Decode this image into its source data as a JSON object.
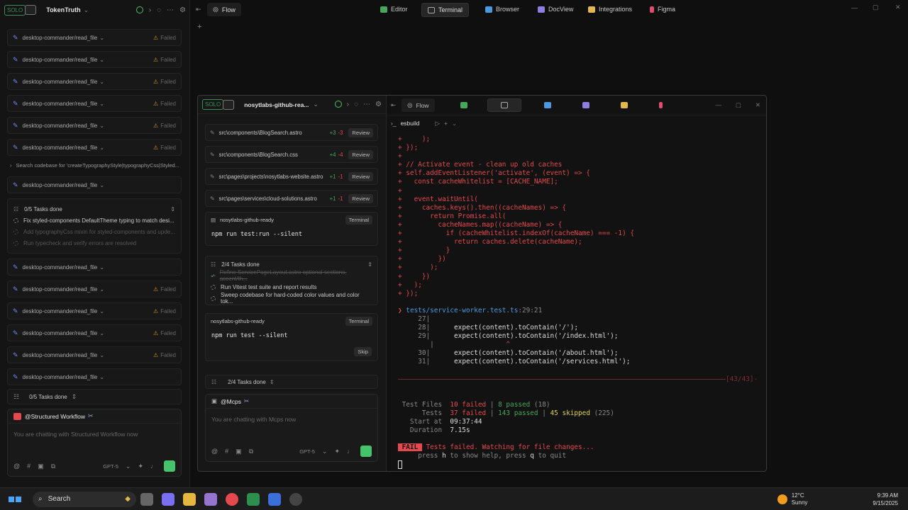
{
  "app": {
    "solo": "SOLO",
    "project": "TokenTruth",
    "top_tabs": [
      {
        "label": "Flow",
        "icon": "flow-icon"
      },
      {
        "label": "Editor",
        "icon": "editor-icon"
      },
      {
        "label": "Terminal",
        "icon": "terminal-icon"
      },
      {
        "label": "Browser",
        "icon": "browser-icon"
      },
      {
        "label": "DocView",
        "icon": "docview-icon"
      },
      {
        "label": "Integrations",
        "icon": "integrations-icon"
      },
      {
        "label": "Figma",
        "icon": "figma-icon"
      }
    ]
  },
  "left_panel": {
    "tool_label": "desktop-commander/read_file",
    "failed": "Failed",
    "search_codebase": "Search codebase for 'createTypographyStyle|typographyCss|Styled...",
    "tasks_done": "0/5 Tasks done",
    "tasks": [
      "Fix styled-components DefaultTheme typing to match desi...",
      "Add typographyCss mixin for styled-components and upde...",
      "Run typecheck and verify errors are resolved"
    ],
    "footer_tasks": "0/5 Tasks done",
    "workflow_title": "@Structured Workflow",
    "workflow_placeholder": "You are chatting with Structured Workflow now",
    "model": "GPT-5"
  },
  "inner": {
    "solo": "SOLO",
    "project": "nosytlabs-github-rea...",
    "files": [
      {
        "path": "src\\components\\BlogSearch.astro",
        "add": "+3",
        "del": "-3"
      },
      {
        "path": "src\\components\\BlogSearch.css",
        "add": "+4",
        "del": "-4"
      },
      {
        "path": "src\\pages\\projects\\nosytlabs-website.astro",
        "add": "+1",
        "del": "-1"
      },
      {
        "path": "src\\pages\\services\\cloud-solutions.astro",
        "add": "+1",
        "del": "-1"
      }
    ],
    "review": "Review",
    "terminal_label": "Terminal",
    "cmd1_project": "nosytlabs-github-ready",
    "cmd1": "npm run test:run --silent",
    "tasks_done": "2/4 Tasks done",
    "tasks": [
      "Refine ServicePageLayout.astro optional sections, accent/th...",
      "Run Vitest test suite and report results",
      "Sweep codebase for hard-coded color values and color tok..."
    ],
    "cmd2_project": "nosytlabs-github-ready",
    "cmd2": "npm run test --silent",
    "skip": "Skip",
    "footer_tasks": "2/4 Tasks done",
    "mcps": "@Mcps",
    "placeholder": "You are chatting with Mcps now",
    "model": "GPT-5",
    "flow": "Flow",
    "term_tab": "esbuild"
  },
  "terminal": {
    "lines": [
      "+     );",
      "+ });",
      "+",
      "+ // Activate event - clean up old caches",
      "+ self.addEventListener('activate', (event) => {",
      "+   const cacheWhitelist = [CACHE_NAME];",
      "+",
      "+   event.waitUntil(",
      "+     caches.keys().then((cacheNames) => {",
      "+       return Promise.all(",
      "+         cacheNames.map((cacheName) => {",
      "+           if (cacheWhitelist.indexOf(cacheName) === -1) {",
      "+             return caches.delete(cacheName);",
      "+           }",
      "+         })",
      "+       );",
      "+     })",
      "+   );",
      "+ });"
    ],
    "loc_file": "tests/service-worker.test.ts",
    "loc_pos": ":29:21",
    "src": [
      {
        "n": "27",
        "code": ""
      },
      {
        "n": "28",
        "code": "expect(content).toContain('/');"
      },
      {
        "n": "29",
        "code": "expect(content).toContain('/index.html');"
      },
      {
        "n": "30",
        "code": "expect(content).toContain('/about.html');"
      },
      {
        "n": "31",
        "code": "expect(content).toContain('/services.html');"
      }
    ],
    "divider_label": "[43/43]",
    "summary": {
      "files_label": "Test Files",
      "files_failed": "10 failed",
      "files_passed": "8 passed",
      "files_total": "(18)",
      "tests_label": "Tests",
      "tests_failed": "37 failed",
      "tests_passed": "143 passed",
      "tests_skipped": "45 skipped",
      "tests_total": "(225)",
      "start_label": "Start at",
      "start": "09:37:44",
      "dur_label": "Duration",
      "dur": "7.15s"
    },
    "fail_badge": "FAIL",
    "fail_msg": "Tests failed. Watching for file changes...",
    "help_a": "press ",
    "help_h": "h",
    "help_b": " to show help, press ",
    "help_q": "q",
    "help_c": " to quit"
  },
  "taskbar": {
    "search": "Search",
    "temp": "12°C",
    "weather": "Sunny",
    "time": "9:39 AM",
    "date": "9/15/2025"
  }
}
